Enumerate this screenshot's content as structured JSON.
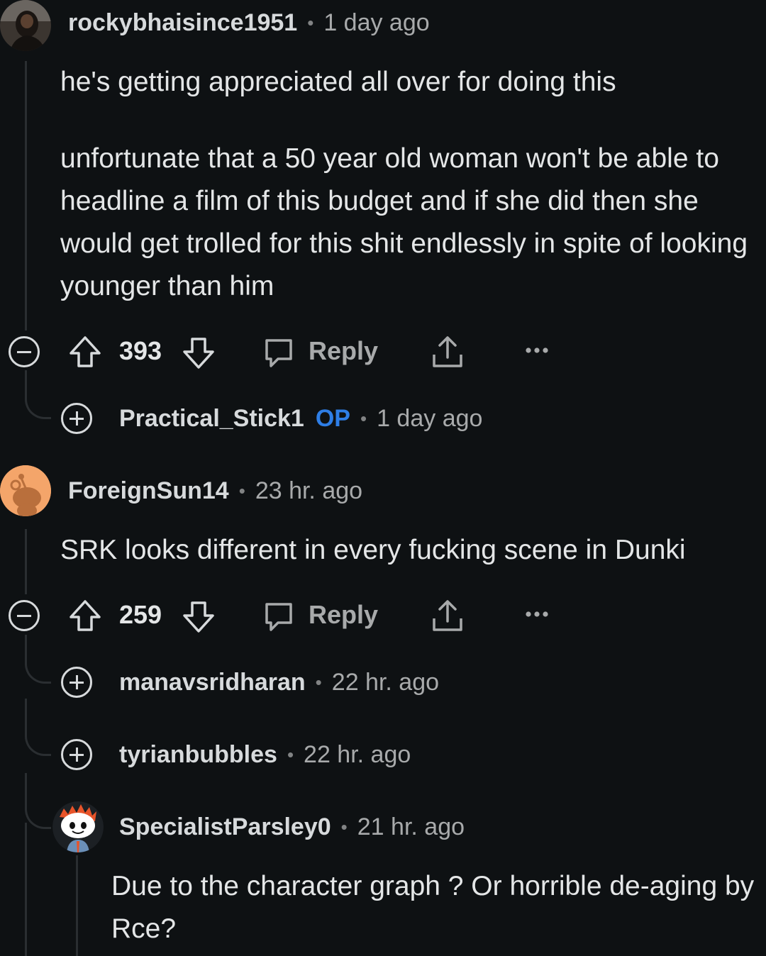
{
  "comments": [
    {
      "username": "rockybhaisince1951",
      "separator": "•",
      "time": "1 day ago",
      "paragraphs": [
        "he's getting appreciated all over for doing this",
        "unfortunate that a 50 year old woman won't be able to headline a film of this budget and if she did then she would get trolled for this shit endlessly in spite of looking younger than him"
      ],
      "score": "393",
      "reply_label": "Reply",
      "collapsed_reply": {
        "username": "Practical_Stick1",
        "op_badge": "OP",
        "separator": "•",
        "time": "1 day ago"
      }
    },
    {
      "username": "ForeignSun14",
      "separator": "•",
      "time": "23 hr. ago",
      "paragraphs": [
        "SRK looks different in every fucking scene in Dunki"
      ],
      "score": "259",
      "reply_label": "Reply",
      "collapsed_replies": [
        {
          "username": "manavsridharan",
          "separator": "•",
          "time": "22 hr. ago"
        },
        {
          "username": "tyrianbubbles",
          "separator": "•",
          "time": "22 hr. ago"
        }
      ],
      "nested_reply": {
        "username": "SpecialistParsley0",
        "separator": "•",
        "time": "21 hr. ago",
        "text": "Due to the character graph ? Or horrible de-aging by Rce?"
      }
    }
  ],
  "theme": {
    "background": "#0e1113",
    "text": "#e4e6e7",
    "muted": "#a8aaab",
    "op_badge": "#2e7ee6",
    "thread_line": "#2a2e31",
    "avatar_orange": "#f4a56a"
  },
  "icons": [
    "collapse-icon",
    "expand-icon",
    "upvote-icon",
    "downvote-icon",
    "reply-icon",
    "share-icon",
    "more-icon"
  ]
}
